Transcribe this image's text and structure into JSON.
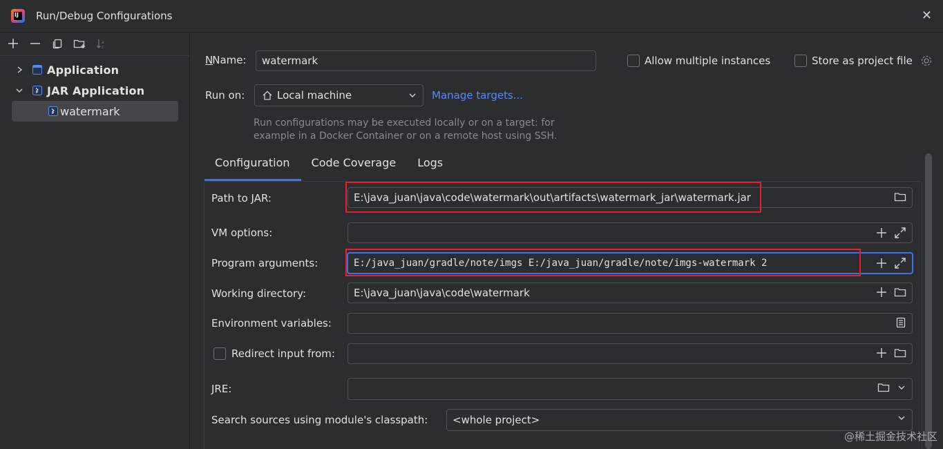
{
  "window": {
    "title": "Run/Debug Configurations"
  },
  "tree": {
    "items": [
      {
        "label": "Application",
        "expanded": false
      },
      {
        "label": "JAR Application",
        "expanded": true
      },
      {
        "label": "watermark",
        "selected": true
      }
    ]
  },
  "form": {
    "name_label": "Name:",
    "name_value": "watermark",
    "allow_multiple_label": "Allow multiple instances",
    "store_project_label": "Store as project file",
    "run_on_label": "Run on:",
    "run_on_value": "Local machine",
    "manage_targets": "Manage targets...",
    "hint": "Run configurations may be executed locally or on a target: for example in a Docker Container or on a remote host using SSH."
  },
  "tabs": [
    {
      "label": "Configuration",
      "active": true
    },
    {
      "label": "Code Coverage",
      "active": false
    },
    {
      "label": "Logs",
      "active": false
    }
  ],
  "config": {
    "path_label": "Path to JAR:",
    "path_value": "E:\\java_juan\\java\\code\\watermark\\out\\artifacts\\watermark_jar\\watermark.jar",
    "vm_label": "VM options:",
    "vm_value": "",
    "args_label": "Program arguments:",
    "args_value": "E:/java_juan/gradle/note/imgs E:/java_juan/gradle/note/imgs-watermark 2",
    "workdir_label": "Working directory:",
    "workdir_value": "E:\\java_juan\\java\\code\\watermark",
    "env_label": "Environment variables:",
    "env_value": "",
    "redirect_label": "Redirect input from:",
    "redirect_value": "",
    "jre_label": "JRE:",
    "jre_value": "",
    "classpath_label": "Search sources using module's classpath:",
    "classpath_value": "<whole project>"
  },
  "watermark": {
    "corner_text": "@稀土掘金技术社区"
  },
  "colors": {
    "background": "#2b2d30",
    "accent": "#3574f0",
    "link": "#548af7",
    "highlight_red": "#e8202a"
  }
}
